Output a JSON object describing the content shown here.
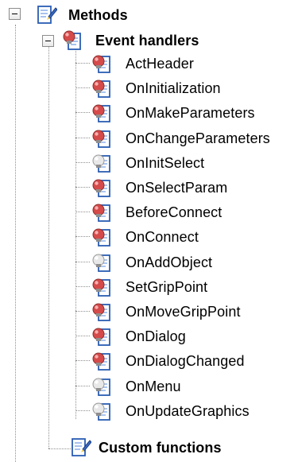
{
  "tree": {
    "methods": {
      "label": "Methods",
      "icon": "method-folder-icon",
      "expanded": true
    },
    "event_handlers": {
      "label": "Event handlers",
      "icon": "event-handlers-folder-icon",
      "expanded": true,
      "items": [
        {
          "label": "ActHeader",
          "icon": "red-bulb-document-icon"
        },
        {
          "label": "OnInitialization",
          "icon": "red-bulb-document-icon"
        },
        {
          "label": "OnMakeParameters",
          "icon": "red-bulb-document-icon"
        },
        {
          "label": "OnChangeParameters",
          "icon": "red-bulb-document-icon"
        },
        {
          "label": "OnInitSelect",
          "icon": "white-bulb-document-icon"
        },
        {
          "label": "OnSelectParam",
          "icon": "red-bulb-document-icon"
        },
        {
          "label": "BeforeConnect",
          "icon": "red-bulb-document-icon"
        },
        {
          "label": "OnConnect",
          "icon": "red-bulb-document-icon"
        },
        {
          "label": "OnAddObject",
          "icon": "white-bulb-document-icon"
        },
        {
          "label": "SetGripPoint",
          "icon": "red-bulb-document-icon"
        },
        {
          "label": "OnMoveGripPoint",
          "icon": "red-bulb-document-icon"
        },
        {
          "label": "OnDialog",
          "icon": "red-bulb-document-icon"
        },
        {
          "label": "OnDialogChanged",
          "icon": "red-bulb-document-icon"
        },
        {
          "label": "OnMenu",
          "icon": "white-bulb-document-icon"
        },
        {
          "label": "OnUpdateGraphics",
          "icon": "white-bulb-document-icon"
        }
      ]
    },
    "custom_functions": {
      "label": "Custom functions",
      "icon": "method-folder-icon"
    }
  },
  "colors": {
    "red_bulb": "#d54a4a",
    "white_bulb": "#e8e8e8",
    "doc_blue": "#2a5db3",
    "doc_lines": "#7fa7e8",
    "tree_lines": "#8f8f8f"
  }
}
